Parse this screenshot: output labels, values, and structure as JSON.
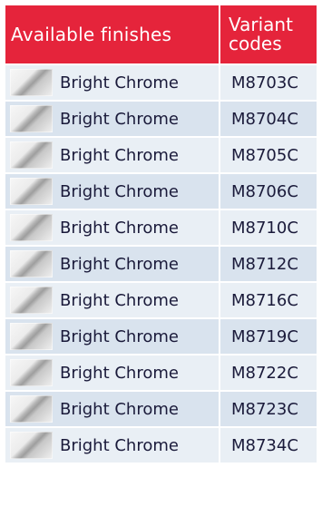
{
  "header": {
    "finishes_label": "Available finishes",
    "codes_label_line1": "Variant",
    "codes_label_line2": "codes"
  },
  "rows": [
    {
      "finish": "Bright Chrome",
      "code": "M8703C"
    },
    {
      "finish": "Bright Chrome",
      "code": "M8704C"
    },
    {
      "finish": "Bright Chrome",
      "code": "M8705C"
    },
    {
      "finish": "Bright Chrome",
      "code": "M8706C"
    },
    {
      "finish": "Bright Chrome",
      "code": "M8710C"
    },
    {
      "finish": "Bright Chrome",
      "code": "M8712C"
    },
    {
      "finish": "Bright Chrome",
      "code": "M8716C"
    },
    {
      "finish": "Bright Chrome",
      "code": "M8719C"
    },
    {
      "finish": "Bright Chrome",
      "code": "M8722C"
    },
    {
      "finish": "Bright Chrome",
      "code": "M8723C"
    },
    {
      "finish": "Bright Chrome",
      "code": "M8734C"
    }
  ],
  "colors": {
    "header_background": "#e5243b",
    "row_light": "#e9eff5",
    "row_dark": "#d9e3ee",
    "text": "#1a1a3a"
  },
  "icons": {
    "swatch": "chrome-swatch-icon"
  }
}
